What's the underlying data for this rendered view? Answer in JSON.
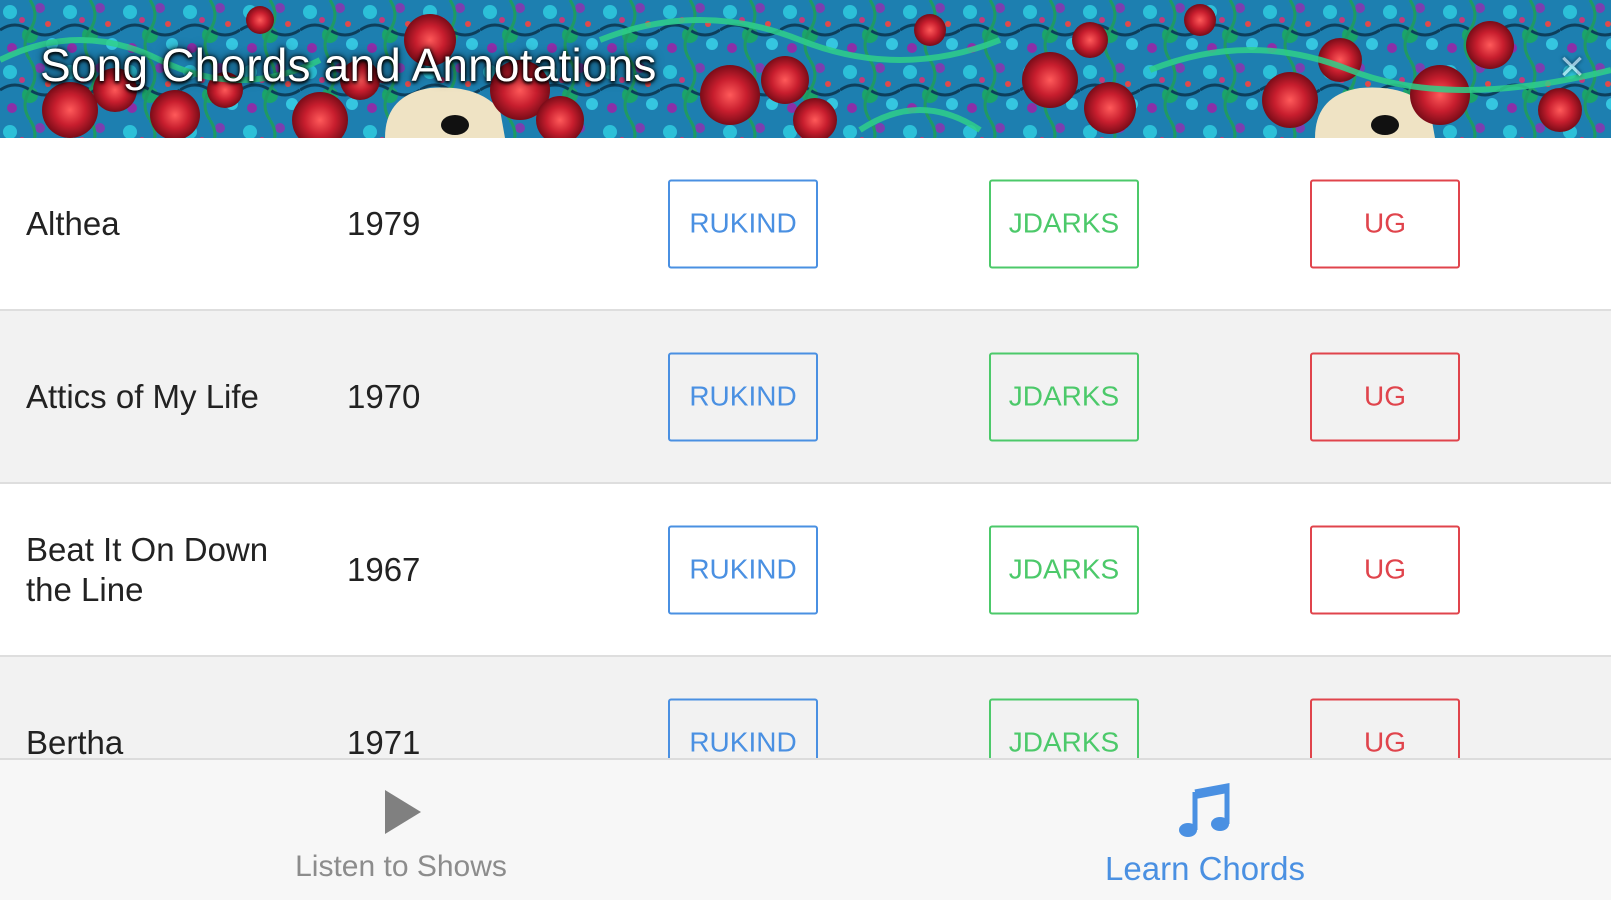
{
  "header": {
    "title": "Song Chords and Annotations"
  },
  "colors": {
    "rukind": "#4a90e2",
    "jdarks": "#4cc96a",
    "ug": "#e0444c",
    "active_tab": "#4a90e2",
    "inactive_tab": "#8c8c8c"
  },
  "songs": [
    {
      "title": "Althea",
      "year": "1979",
      "buttons": [
        "RUKIND",
        "JDARKS",
        "UG"
      ]
    },
    {
      "title": "Attics of My Life",
      "year": "1970",
      "buttons": [
        "RUKIND",
        "JDARKS",
        "UG"
      ]
    },
    {
      "title": "Beat It On Down the Line",
      "year": "1967",
      "buttons": [
        "RUKIND",
        "JDARKS",
        "UG"
      ]
    },
    {
      "title": "Bertha",
      "year": "1971",
      "buttons": [
        "RUKIND",
        "JDARKS",
        "UG"
      ]
    }
  ],
  "tabs": [
    {
      "label": "Listen to Shows",
      "icon": "play-icon",
      "active": false
    },
    {
      "label": "Learn Chords",
      "icon": "music-note-icon",
      "active": true
    }
  ]
}
